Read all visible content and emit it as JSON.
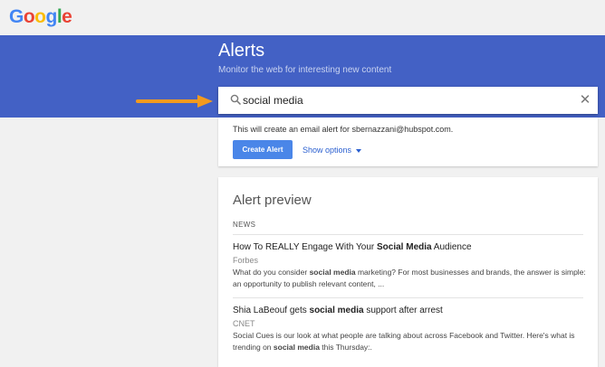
{
  "logo": {
    "letters": [
      "G",
      "o",
      "o",
      "g",
      "l",
      "e"
    ],
    "colors": [
      "#4285f4",
      "#ea4335",
      "#fbbc05",
      "#4285f4",
      "#34a853",
      "#ea4335"
    ]
  },
  "hero": {
    "title": "Alerts",
    "subtitle": "Monitor the web for interesting new content",
    "background": "#4361c5"
  },
  "search": {
    "value": "social media",
    "icon": "search-icon",
    "close_glyph": "✕"
  },
  "annotation": {
    "arrow_color": "#f39a1e"
  },
  "options": {
    "note": "This will create an email alert for sbernazzani@hubspot.com.",
    "create_label": "Create Alert",
    "show_options_label": "Show options"
  },
  "preview": {
    "title": "Alert preview",
    "section_label": "NEWS",
    "items": [
      {
        "title_pre": "How To REALLY Engage With Your ",
        "title_bold": "Social Media",
        "title_post": " Audience",
        "source": "Forbes",
        "snippet_pre": "What do you consider ",
        "snippet_bold": "social media",
        "snippet_post": " marketing? For most businesses and brands, the answer is simple: an opportunity to publish relevant content, ..."
      },
      {
        "title_pre": "Shia LaBeouf gets ",
        "title_bold": "social media",
        "title_post": " support after arrest",
        "source": "CNET",
        "snippet_pre": "Social Cues is our look at what people are talking about across Facebook and Twitter. Here's what is trending on ",
        "snippet_bold": "social media",
        "snippet_post": " this Thursday:."
      }
    ]
  }
}
